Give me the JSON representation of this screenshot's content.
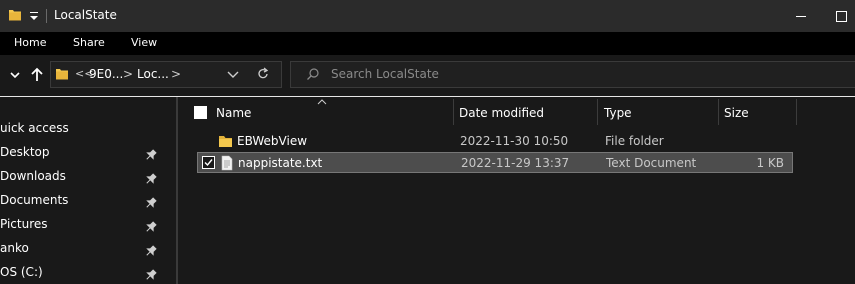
{
  "window": {
    "title": "LocalState"
  },
  "ribbon": {
    "tabs": [
      "Home",
      "Share",
      "View"
    ]
  },
  "address": {
    "overflow": "<<",
    "segments": [
      "9E0...",
      "Loc..."
    ],
    "separator": ">"
  },
  "search": {
    "placeholder": "Search LocalState"
  },
  "navigation": {
    "items": [
      {
        "label": "uick access",
        "pinned": false
      },
      {
        "label": "Desktop",
        "pinned": true
      },
      {
        "label": "Downloads",
        "pinned": true
      },
      {
        "label": "Documents",
        "pinned": true
      },
      {
        "label": "Pictures",
        "pinned": true
      },
      {
        "label": "anko",
        "pinned": true
      },
      {
        "label": "OS (C:)",
        "pinned": true
      }
    ]
  },
  "columns": {
    "name": "Name",
    "date": "Date modified",
    "type": "Type",
    "size": "Size"
  },
  "files": [
    {
      "name": "EBWebView",
      "date": "2022-11-30 10:50",
      "type": "File folder",
      "size": "",
      "icon": "folder-icon",
      "selected": false,
      "checked": false
    },
    {
      "name": "nappistate.txt",
      "date": "2022-11-29 13:37",
      "type": "Text Document",
      "size": "1 KB",
      "icon": "text-file-icon",
      "selected": true,
      "checked": true
    }
  ],
  "colors": {
    "titlebar": "#2b2b2b",
    "ribbon": "#000000",
    "background": "#191919",
    "folder": "#f4c84e",
    "selection": "#4d4d4d"
  }
}
